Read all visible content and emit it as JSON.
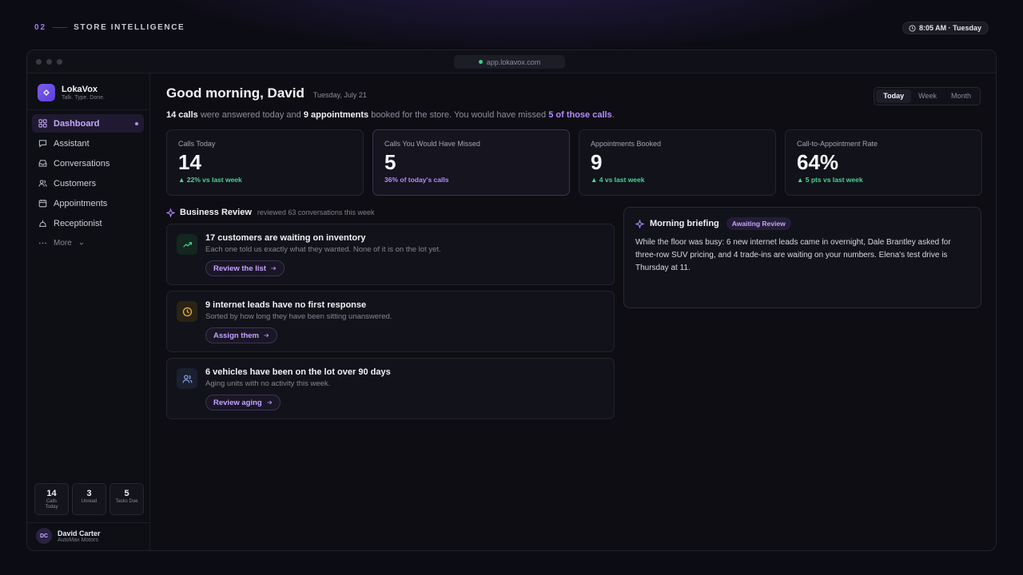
{
  "header": {
    "section_number": "02",
    "section_title": "STORE INTELLIGENCE",
    "clock": "8:05 AM · Tuesday"
  },
  "browser": {
    "url": "app.lokavox.com"
  },
  "brand": {
    "name": "LokaVox",
    "tagline": "Talk. Type. Done."
  },
  "sidebar": {
    "items": [
      {
        "label": "Dashboard",
        "icon": "grid-icon",
        "active": true
      },
      {
        "label": "Assistant",
        "icon": "chat-icon"
      },
      {
        "label": "Conversations",
        "icon": "inbox-icon"
      },
      {
        "label": "Customers",
        "icon": "users-icon"
      },
      {
        "label": "Appointments",
        "icon": "calendar-icon"
      },
      {
        "label": "Receptionist",
        "icon": "bell-icon"
      }
    ],
    "more_label": "More",
    "stats": [
      {
        "value": "14",
        "label": "Calls Today"
      },
      {
        "value": "3",
        "label": "Unread"
      },
      {
        "value": "5",
        "label": "Tasks Due"
      }
    ],
    "user": {
      "initials": "DC",
      "name": "David Carter",
      "org": "AutoMax Motors"
    }
  },
  "main": {
    "greeting": "Good morning, David",
    "date": "Tuesday, July 21",
    "range_tabs": [
      {
        "label": "Today",
        "active": true
      },
      {
        "label": "Week",
        "active": false
      },
      {
        "label": "Month",
        "active": false
      }
    ],
    "summary": {
      "calls": "14 calls",
      "part1": " were answered today and ",
      "appointments": "9 appointments",
      "part2": " booked for the store. You would have missed ",
      "missed": "5 of those calls",
      "end": "."
    },
    "kpis": [
      {
        "label": "Calls Today",
        "value": "14",
        "delta": "▲ 22% vs last week",
        "tone": "green"
      },
      {
        "label": "Calls You Would Have Missed",
        "value": "5",
        "delta": "36% of today's calls",
        "tone": "purple"
      },
      {
        "label": "Appointments Booked",
        "value": "9",
        "delta": "▲ 4 vs last week",
        "tone": "green"
      },
      {
        "label": "Call-to-Appointment Rate",
        "value": "64%",
        "delta": "▲ 5 pts vs last week",
        "tone": "green"
      }
    ],
    "review": {
      "title": "Business Review",
      "subtitle": "reviewed 63 conversations this week",
      "tasks": [
        {
          "title": "17 customers are waiting on inventory",
          "desc": "Each one told us exactly what they wanted. None of it is on the lot yet.",
          "button": "Review the list",
          "icon": "trending-up-icon"
        },
        {
          "title": "9 internet leads have no first response",
          "desc": "Sorted by how long they have been sitting unanswered.",
          "button": "Assign them",
          "icon": "clock-icon"
        },
        {
          "title": "6 vehicles have been on the lot over 90 days",
          "desc": "Aging units with no activity this week.",
          "button": "Review aging",
          "icon": "users-icon"
        }
      ]
    },
    "briefing": {
      "title": "Morning briefing",
      "badge": "Awaiting Review",
      "text": "While the floor was busy: 6 new internet leads came in overnight, Dale Brantley asked for three-row SUV pricing, and 4 trade-ins are waiting on your numbers. Elena's test drive is Thursday at 11."
    }
  },
  "colors": {
    "accent": "#b48bff",
    "positive": "#44d690",
    "background": "#0b0b12"
  }
}
